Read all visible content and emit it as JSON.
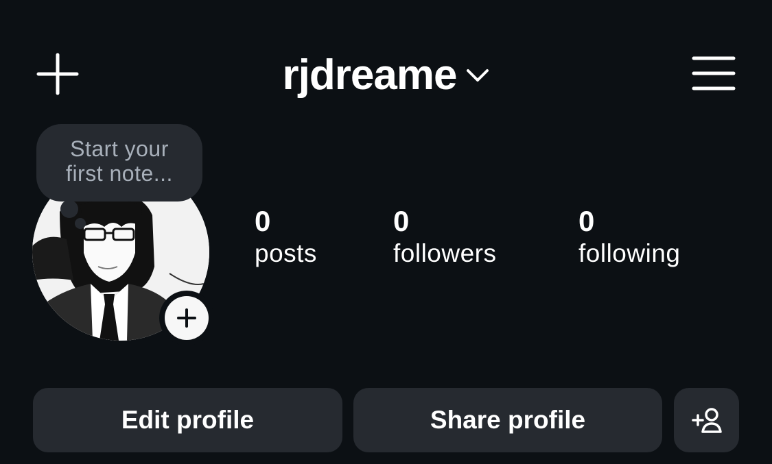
{
  "header": {
    "username": "rjdreame",
    "new_post_icon": "plus-icon",
    "account_switch_icon": "chevron-down-icon",
    "menu_icon": "hamburger-menu-icon"
  },
  "note": {
    "line1": "Start your",
    "line2": "first note..."
  },
  "avatar": {
    "add_story_icon": "plus-icon"
  },
  "stats": {
    "posts": {
      "count": "0",
      "label": "posts"
    },
    "followers": {
      "count": "0",
      "label": "followers"
    },
    "following": {
      "count": "0",
      "label": "following"
    }
  },
  "actions": {
    "edit_profile": "Edit profile",
    "share_profile": "Share profile",
    "suggest_icon": "add-person-icon"
  },
  "colors": {
    "background": "#0c1014",
    "surface": "#262a30",
    "text": "#ffffff",
    "muted_text": "#a8b0ba"
  }
}
